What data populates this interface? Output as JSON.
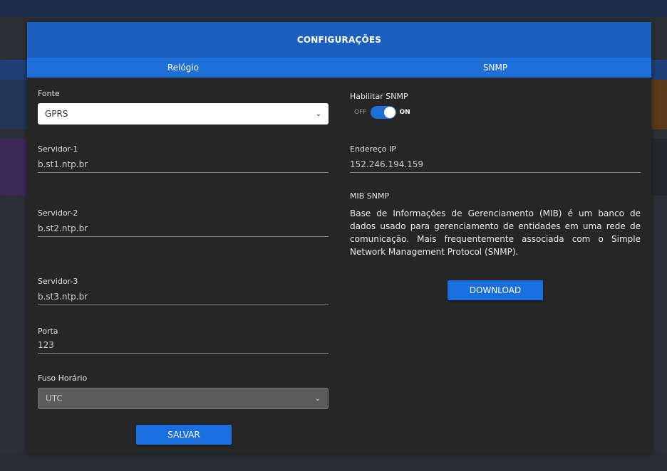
{
  "modal": {
    "title": "CONFIGURAÇÕES",
    "tabs": [
      "Relógio",
      "SNMP"
    ]
  },
  "clock": {
    "fonte": {
      "label": "Fonte",
      "value": "GPRS"
    },
    "servidor1": {
      "label": "Servidor-1",
      "value": "b.st1.ntp.br"
    },
    "servidor2": {
      "label": "Servidor-2",
      "value": "b.st2.ntp.br"
    },
    "servidor3": {
      "label": "Servidor-3",
      "value": "b.st3.ntp.br"
    },
    "porta": {
      "label": "Porta",
      "value": "123"
    },
    "fuso": {
      "label": "Fuso Horário",
      "value": "UTC"
    },
    "save_label": "SALVAR"
  },
  "snmp": {
    "enable": {
      "label": "Habilitar SNMP",
      "off": "OFF",
      "on": "ON",
      "checked": true
    },
    "ip": {
      "label": "Endereço IP",
      "value": "152.246.194.159"
    },
    "mib": {
      "label": "MIB SNMP",
      "description": "Base de Informações de Gerenciamento (MIB) é um banco de dados usado para gerenciamento de entidades em uma rede de comunicação. Mais frequentemente associada com o Simple Network Management Protocol (SNMP)."
    },
    "download_label": "DOWNLOAD"
  },
  "colors": {
    "header": "#1b5fc0",
    "subheader": "#1e6fd8",
    "button": "#1a6fe0",
    "panel": "#262626"
  },
  "icons": {
    "select_arrow": "chevron-down-icon"
  }
}
